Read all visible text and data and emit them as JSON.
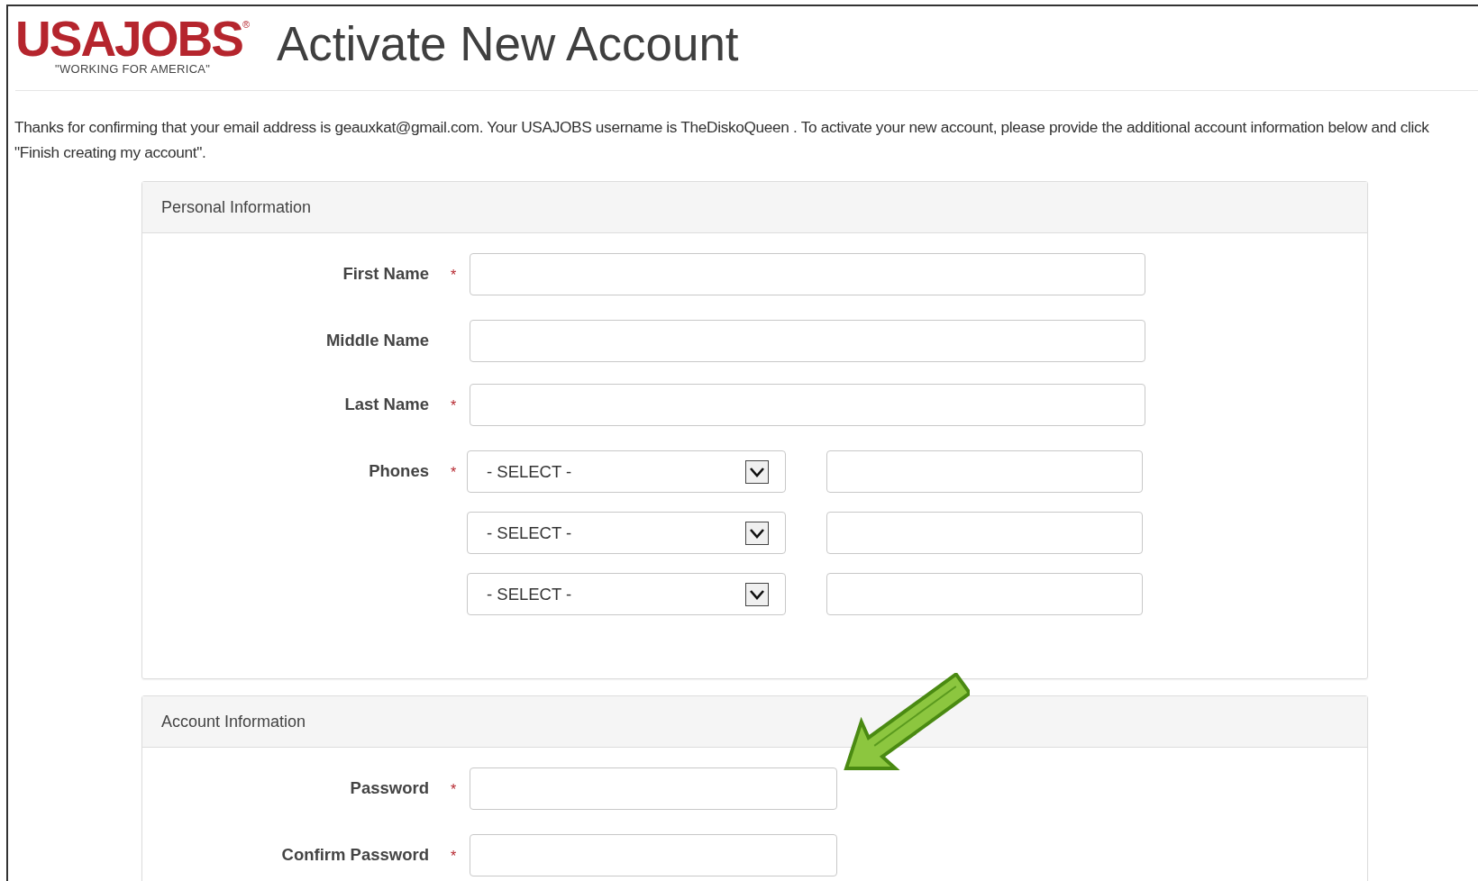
{
  "header": {
    "logo": {
      "wordmark": "USAJOBS",
      "mark": "®",
      "tagline": "\"WORKING FOR AMERICA\""
    },
    "title": "Activate New Account"
  },
  "intro": "Thanks for confirming that your email address is geauxkat@gmail.com. Your USAJOBS username is TheDiskoQueen . To activate your new account, please provide the additional account information below and click \"Finish creating my account\".",
  "sections": [
    {
      "title": "Personal Information",
      "fields": [
        {
          "kind": "text",
          "label": "First Name",
          "marker": "*"
        },
        {
          "kind": "text",
          "label": "Middle Name"
        },
        {
          "kind": "text",
          "label": "Last Name",
          "marker": "*"
        },
        {
          "kind": "phones",
          "label": "Phones",
          "marker": "*",
          "rows": [
            {
              "select": "- SELECT -"
            },
            {
              "select": "- SELECT -"
            },
            {
              "select": "- SELECT -"
            }
          ]
        }
      ]
    },
    {
      "title": "Account Information",
      "fields": [
        {
          "kind": "password",
          "label": "Password",
          "marker": "*"
        },
        {
          "kind": "password",
          "label": "Confirm Password",
          "marker": "*"
        }
      ]
    }
  ]
}
